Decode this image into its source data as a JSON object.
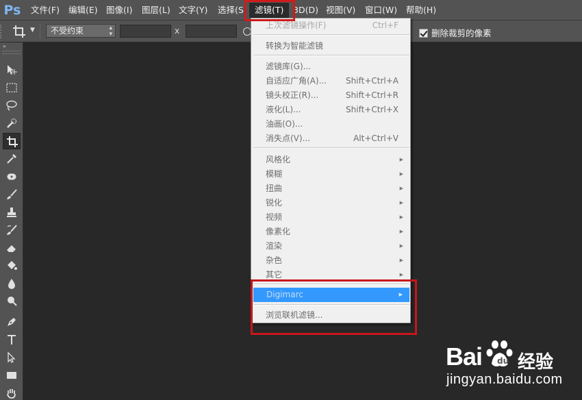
{
  "app": {
    "logo_text": "Ps"
  },
  "menubar": {
    "file": "文件(F)",
    "edit": "编辑(E)",
    "image": "图像(I)",
    "layer": "图层(L)",
    "type": "文字(Y)",
    "select": "选择(S)",
    "filter": "滤镜(T)",
    "three_d": "3D(D)",
    "view": "视图(V)",
    "window": "窗口(W)",
    "help": "帮助(H)",
    "active_menu": "filter"
  },
  "options_bar": {
    "ratio_select": "不受约束",
    "width_value": "",
    "x_label": "x",
    "height_value": "",
    "delete_cropped_label": "删除裁剪的像素",
    "delete_cropped_checked": true
  },
  "tools": [
    {
      "name": "move-tool",
      "selected": false
    },
    {
      "name": "rect-marquee-tool",
      "selected": false
    },
    {
      "name": "lasso-tool",
      "selected": false
    },
    {
      "name": "quick-select-tool",
      "selected": false
    },
    {
      "name": "crop-tool",
      "selected": true
    },
    {
      "name": "eyedropper-tool",
      "selected": false
    },
    {
      "name": "spot-healing-tool",
      "selected": false
    },
    {
      "name": "brush-tool",
      "selected": false
    },
    {
      "name": "clone-stamp-tool",
      "selected": false
    },
    {
      "name": "history-brush-tool",
      "selected": false
    },
    {
      "name": "eraser-tool",
      "selected": false
    },
    {
      "name": "paint-bucket-tool",
      "selected": false
    },
    {
      "name": "blur-tool",
      "selected": false
    },
    {
      "name": "dodge-tool",
      "selected": false
    },
    {
      "name": "pen-tool",
      "selected": false
    },
    {
      "name": "type-tool",
      "selected": false
    },
    {
      "name": "path-selection-tool",
      "selected": false
    },
    {
      "name": "rectangle-tool",
      "selected": false
    },
    {
      "name": "hand-tool",
      "selected": false
    }
  ],
  "filter_menu": {
    "last_filter": {
      "label": "上次滤镜操作(F)",
      "shortcut": "Ctrl+F",
      "disabled": true
    },
    "convert_smart": {
      "label": "转换为智能滤镜"
    },
    "gallery": {
      "label": "滤镜库(G)..."
    },
    "adaptive_wide": {
      "label": "自适应广角(A)...",
      "shortcut": "Shift+Ctrl+A"
    },
    "lens_correction": {
      "label": "镜头校正(R)...",
      "shortcut": "Shift+Ctrl+R"
    },
    "liquify": {
      "label": "液化(L)...",
      "shortcut": "Shift+Ctrl+X"
    },
    "oil_paint": {
      "label": "油画(O)..."
    },
    "vanishing_point": {
      "label": "消失点(V)...",
      "shortcut": "Alt+Ctrl+V"
    },
    "stylize": {
      "label": "风格化"
    },
    "blur": {
      "label": "模糊"
    },
    "distort": {
      "label": "扭曲"
    },
    "sharpen": {
      "label": "锐化"
    },
    "video": {
      "label": "视频"
    },
    "pixelate": {
      "label": "像素化"
    },
    "render": {
      "label": "渲染"
    },
    "noise": {
      "label": "杂色"
    },
    "other": {
      "label": "其它"
    },
    "digimarc": {
      "label": "Digimarc",
      "highlighted": true
    },
    "browse_online": {
      "label": "浏览联机滤镜..."
    }
  },
  "watermark": {
    "brand_bai": "Bai",
    "brand_du": "经验",
    "url": "jingyan.baidu.com"
  },
  "colors": {
    "menubar_bg": "#535353",
    "canvas_bg": "#282828",
    "menu_bg": "#f0f0f0",
    "highlight": "#3399ff",
    "annotation_red": "#d11a1a"
  }
}
